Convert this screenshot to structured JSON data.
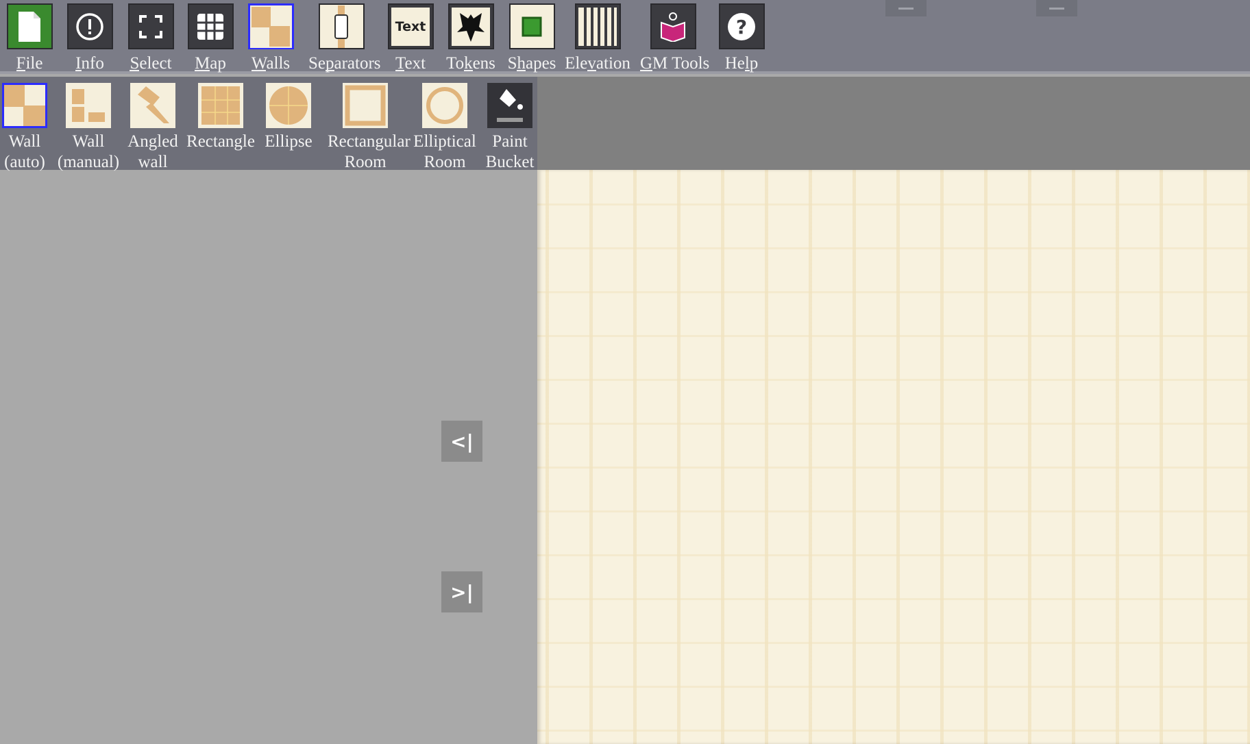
{
  "toolbar": {
    "items": [
      {
        "label": "File",
        "key": "F",
        "icon": "file-icon"
      },
      {
        "label": "Info",
        "key": "I",
        "icon": "info-icon"
      },
      {
        "label": "Select",
        "key": "S",
        "icon": "select-icon"
      },
      {
        "label": "Map",
        "key": "M",
        "icon": "map-grid-icon"
      },
      {
        "label": "Walls",
        "key": "W",
        "icon": "walls-icon",
        "selected": true
      },
      {
        "label": "Separators",
        "key": "p",
        "icon": "separator-icon"
      },
      {
        "label": "Text",
        "key": "T",
        "icon": "text-icon",
        "icon_text": "Text"
      },
      {
        "label": "Tokens",
        "key": "k",
        "icon": "dragon-token-icon"
      },
      {
        "label": "Shapes",
        "key": "h",
        "icon": "shapes-icon"
      },
      {
        "label": "Elevation",
        "key": "v",
        "icon": "elevation-icon"
      },
      {
        "label": "GM Tools",
        "key": "G",
        "icon": "gm-book-icon"
      },
      {
        "label": "Help",
        "key": "l",
        "icon": "help-icon"
      }
    ]
  },
  "walls_tools": {
    "items": [
      {
        "line1": "Wall",
        "line2": "(auto)",
        "icon": "wall-auto-icon",
        "selected": true
      },
      {
        "line1": "Wall",
        "line2": "(manual)",
        "icon": "wall-manual-icon"
      },
      {
        "line1": "Angled",
        "line2": "wall",
        "icon": "angled-wall-icon"
      },
      {
        "line1": "Rectangle",
        "line2": "",
        "icon": "rectangle-icon"
      },
      {
        "line1": "Ellipse",
        "line2": "",
        "icon": "ellipse-icon"
      },
      {
        "line1": "Rectangular",
        "line2": "Room",
        "icon": "rectangular-room-icon"
      },
      {
        "line1": "Elliptical",
        "line2": "Room",
        "icon": "elliptical-room-icon"
      },
      {
        "line1": "Paint",
        "line2": "Bucket",
        "icon": "paint-bucket-icon"
      }
    ]
  },
  "panel": {
    "collapse_left": "<|",
    "collapse_right": ">|"
  },
  "colors": {
    "accent_selected": "#2c2cff",
    "wall_tan": "#e0b47c",
    "canvas": "#f8f2df",
    "file_green": "#3a8a2e",
    "gm_magenta": "#c8267a"
  }
}
